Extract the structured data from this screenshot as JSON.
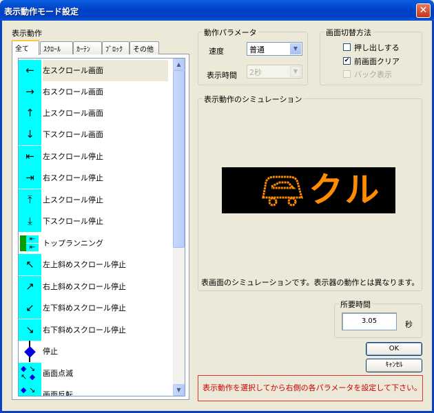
{
  "window": {
    "title": "表示動作モード設定",
    "close_glyph": "✕"
  },
  "left": {
    "section_label": "表示動作",
    "tabs": [
      {
        "label": "全て",
        "active": true
      },
      {
        "label": "ｽｸﾛｰﾙ"
      },
      {
        "label": "ｶｰﾃﾝ"
      },
      {
        "label": "ﾌﾞﾛｯｸ"
      },
      {
        "label": "その他"
      }
    ],
    "items": [
      {
        "icon": "←",
        "icon_name": "arrow-left-icon",
        "label": "左スクロール画面",
        "selected": true
      },
      {
        "icon": "→",
        "icon_name": "arrow-right-icon",
        "label": "右スクロール画面"
      },
      {
        "icon": "↑",
        "icon_name": "arrow-up-icon",
        "label": "上スクロール画面"
      },
      {
        "icon": "↓",
        "icon_name": "arrow-down-icon",
        "label": "下スクロール画面"
      },
      {
        "icon": "⇤",
        "icon_name": "arrow-left-bar-icon",
        "label": "左スクロール停止"
      },
      {
        "icon": "⇥",
        "icon_name": "arrow-right-bar-icon",
        "label": "右スクロール停止"
      },
      {
        "icon": "⤒",
        "icon_name": "arrow-up-bar-icon",
        "label": "上スクロール停止"
      },
      {
        "icon": "⤓",
        "icon_name": "arrow-down-bar-icon",
        "label": "下スクロール停止"
      },
      {
        "icon": "⇤",
        "icon_name": "top-running-icon",
        "label": "トップランニング",
        "special": "green"
      },
      {
        "icon": "↖",
        "icon_name": "arrow-up-left-icon",
        "label": "左上斜めスクロール停止"
      },
      {
        "icon": "↗",
        "icon_name": "arrow-up-right-icon",
        "label": "右上斜めスクロール停止"
      },
      {
        "icon": "↙",
        "icon_name": "arrow-down-left-icon",
        "label": "左下斜めスクロール停止"
      },
      {
        "icon": "↘",
        "icon_name": "arrow-down-right-icon",
        "label": "右下斜めスクロール停止"
      },
      {
        "icon": "◆",
        "icon_name": "stop-diamond-icon",
        "label": "停止",
        "special": "diamond"
      },
      {
        "icon": "◆",
        "icon_name": "screen-blink-icon",
        "label": "画面点滅",
        "special": "blink"
      },
      {
        "icon": "◆",
        "icon_name": "screen-invert-icon",
        "label": "画面反転",
        "special": "blink"
      }
    ]
  },
  "params": {
    "legend": "動作パラメータ",
    "speed_label": "速度",
    "speed_value": "普通",
    "time_label": "表示時間",
    "time_value": "2秒"
  },
  "switch": {
    "legend": "画面切替方法",
    "options": [
      {
        "label": "押し出しする",
        "checked": false,
        "disabled": false
      },
      {
        "label": "前画面クリア",
        "checked": true,
        "disabled": false
      },
      {
        "label": "バック表示",
        "checked": false,
        "disabled": true
      }
    ]
  },
  "simulation": {
    "legend": "表示動作のシミュレーション",
    "display_text": "クル",
    "note": "表画面のシミュレーションです。表示器の動作とは異なります。",
    "led_color": "#FF8C00"
  },
  "duration": {
    "legend": "所要時間",
    "value": "3.05",
    "unit": "秒"
  },
  "buttons": {
    "ok": "OK",
    "cancel": "ｷｬﾝｾﾙ"
  },
  "message": "表示動作を選択してから右側の各パラメータを設定して下さい。"
}
